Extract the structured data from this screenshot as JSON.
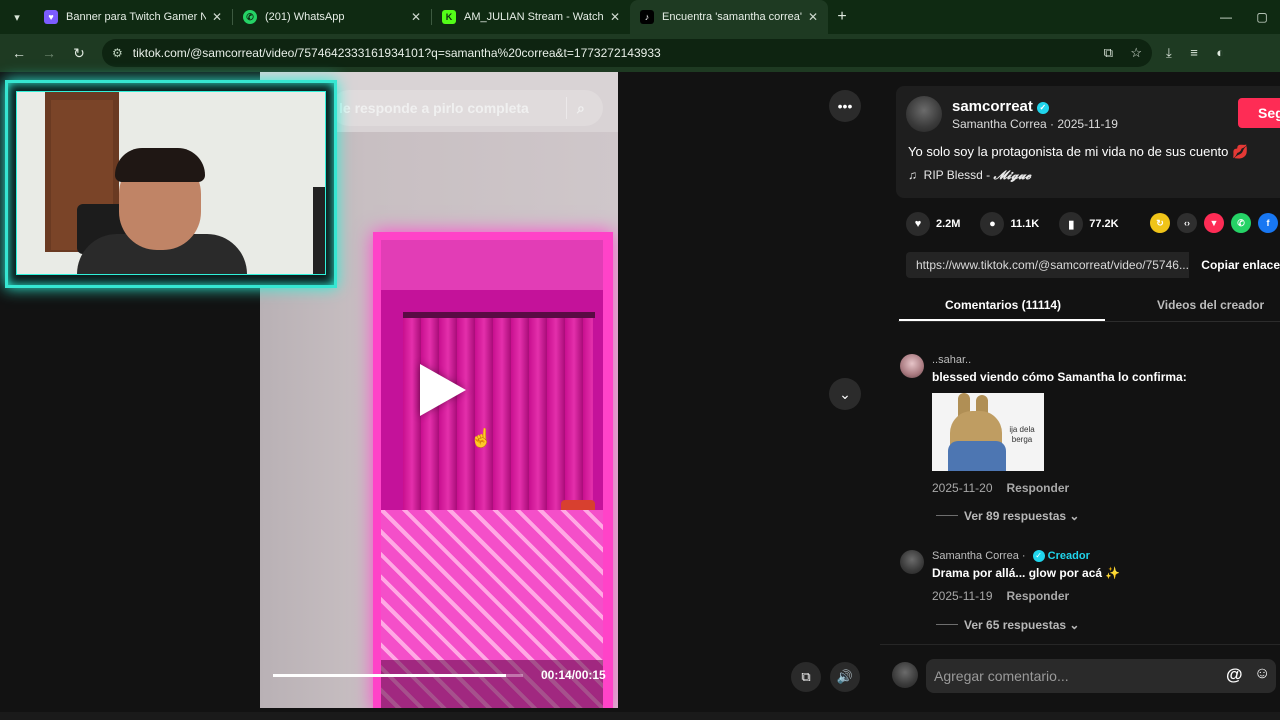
{
  "browser": {
    "tabs": [
      {
        "title": "Banner para Twitch Gamer Neó",
        "favicon": "twitch-banner-icon",
        "color": "#7c5cff",
        "glyph": "♥",
        "active": false
      },
      {
        "title": "(201) WhatsApp",
        "favicon": "whatsapp-icon",
        "color": "#25d366",
        "glyph": "✆",
        "active": false
      },
      {
        "title": "AM_JULIAN Stream - Watch Liv",
        "favicon": "kick-icon",
        "color": "#53fc18",
        "glyph": "K",
        "active": false
      },
      {
        "title": "Encuentra 'samantha correa' en",
        "favicon": "tiktok-icon",
        "color": "#000000",
        "glyph": "♪",
        "active": true
      }
    ],
    "url": "tiktok.com/@samcorreat/video/7574642333161934101?q=samantha%20correa&t=1773272143933"
  },
  "video": {
    "search_query": "le responde a pirlo completa",
    "time": "00:14/00:15",
    "progress": 0.93
  },
  "creator": {
    "username": "samcorreat",
    "display_name": "Samantha Correa · 2025-11-19",
    "follow_label": "Seguir",
    "description": "Yo solo soy la protagonista de mi vida no de sus cuento 💋",
    "music_note": "♫",
    "music_title": "RIP Blessd - ",
    "music_artist": "𝓜𝓲𝓰𝓾𝓮"
  },
  "stats": {
    "likes": "2.2M",
    "comments": "11.1K",
    "saves": "77.2K"
  },
  "share_link": {
    "url": "https://www.tiktok.com/@samcorreat/video/75746...",
    "copy_label": "Copiar enlace"
  },
  "tabs": {
    "comments": "Comentarios (11114)",
    "creator_videos": "Videos del creador"
  },
  "comments": [
    {
      "user": "..sahar..",
      "text": "blessed viendo cómo Samantha lo confirma:",
      "gif_caption": "ija dela berga",
      "date": "2025-11-20",
      "reply_label": "Responder",
      "replies": "Ver 89 respuestas"
    },
    {
      "user": "Samantha Correa · ",
      "creator_tag": "Creador",
      "text": "Drama por allá... glow por acá ✨",
      "date": "2025-11-19",
      "reply_label": "Responder",
      "replies": "Ver 65 respuestas"
    }
  ],
  "add_comment": {
    "placeholder": "Agregar comentario...",
    "mention_symbol": "@",
    "emoji_symbol": "☺"
  },
  "colors": {
    "accent_follow": "#fe2c55",
    "verified": "#20d5ec",
    "cam_border": "#36e6d2"
  }
}
